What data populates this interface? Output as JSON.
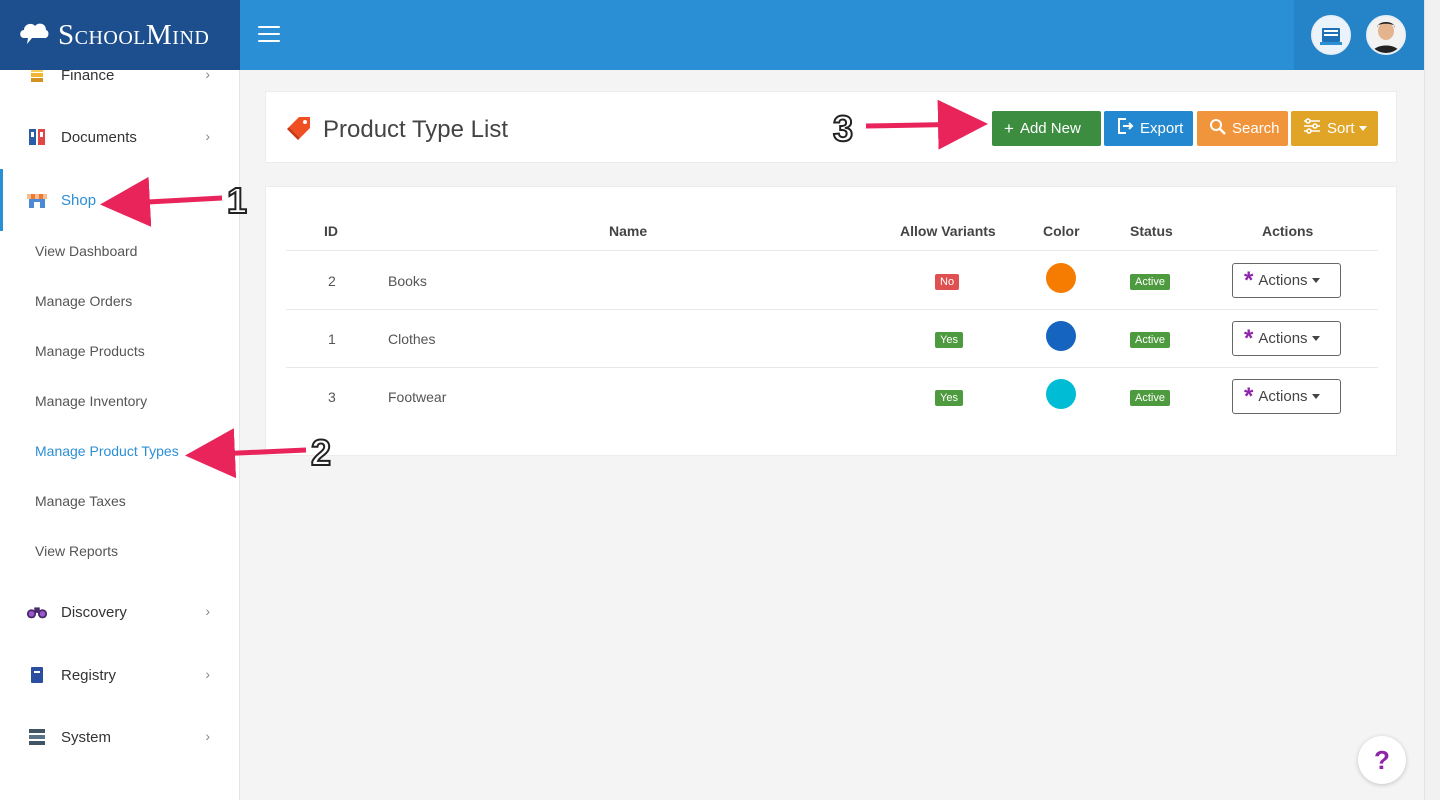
{
  "brand": {
    "name": "SchoolMind"
  },
  "sidebar": {
    "items": [
      {
        "label": "Finance",
        "icon": "finance-icon"
      },
      {
        "label": "Documents",
        "icon": "documents-icon"
      },
      {
        "label": "Shop",
        "icon": "shop-icon",
        "active": true
      },
      {
        "label": "Discovery",
        "icon": "binoculars-icon"
      },
      {
        "label": "Registry",
        "icon": "registry-icon"
      },
      {
        "label": "System",
        "icon": "system-icon"
      }
    ],
    "sub_items": [
      {
        "label": "View Dashboard"
      },
      {
        "label": "Manage Orders"
      },
      {
        "label": "Manage Products"
      },
      {
        "label": "Manage Inventory"
      },
      {
        "label": "Manage Product Types",
        "active": true
      },
      {
        "label": "Manage Taxes"
      },
      {
        "label": "View Reports"
      }
    ]
  },
  "header": {
    "title": "Product Type List",
    "buttons": {
      "add_new": "Add New",
      "export": "Export",
      "search": "Search",
      "sort": "Sort"
    }
  },
  "table": {
    "columns": [
      "ID",
      "Name",
      "Allow Variants",
      "Color",
      "Status",
      "Actions"
    ],
    "rows": [
      {
        "id": "2",
        "name": "Books",
        "allow_variants": "No",
        "color": "#f57c00",
        "status": "Active",
        "actions": "Actions"
      },
      {
        "id": "1",
        "name": "Clothes",
        "allow_variants": "Yes",
        "color": "#1565c0",
        "status": "Active",
        "actions": "Actions"
      },
      {
        "id": "3",
        "name": "Footwear",
        "allow_variants": "Yes",
        "color": "#00bcd4",
        "status": "Active",
        "actions": "Actions"
      }
    ]
  },
  "help": {
    "label": "?"
  },
  "annotations": {
    "one": "1",
    "two": "2",
    "three": "3"
  },
  "colors": {
    "topbar": "#2b8fd6",
    "brand_bg": "#1d4f8e",
    "add_new": "#3c8d40",
    "export": "#2388cf",
    "search": "#f0953c",
    "sort": "#e0a526",
    "badge_no": "#e05050",
    "badge_yes": "#4e9a3e",
    "badge_active": "#4e9a3e",
    "arrow": "#e8245a"
  }
}
